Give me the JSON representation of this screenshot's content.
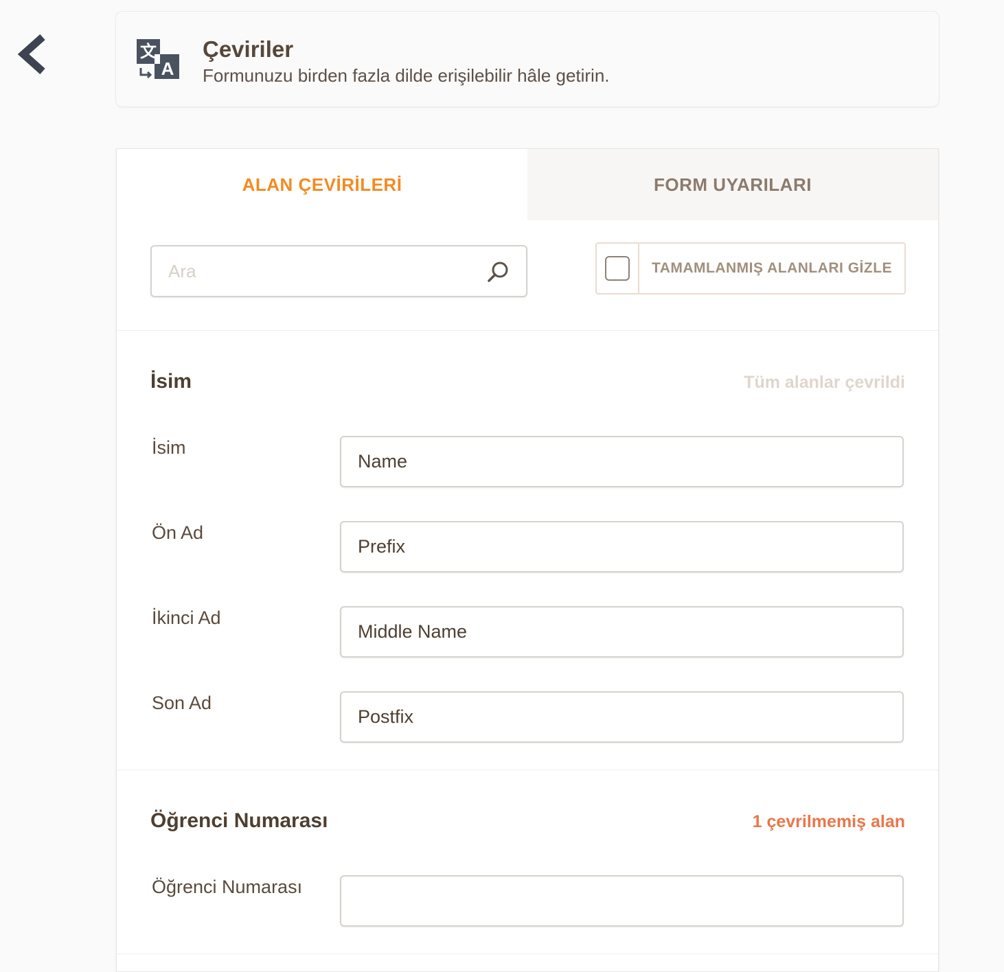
{
  "header": {
    "title": "Çeviriler",
    "subtitle": "Formunuzu birden fazla dilde erişilebilir hâle getirin."
  },
  "tabs": [
    {
      "label": "ALAN ÇEVİRİLERİ",
      "active": true
    },
    {
      "label": "FORM UYARILARI",
      "active": false
    }
  ],
  "search": {
    "placeholder": "Ara",
    "value": ""
  },
  "hide_completed": {
    "label": "TAMAMLANMIŞ ALANLARI GİZLE",
    "checked": false
  },
  "sections": [
    {
      "title": "İsim",
      "status": "Tüm alanlar çevrildi",
      "fields": [
        {
          "label": "İsim",
          "value": "Name"
        },
        {
          "label": "Ön Ad",
          "value": "Prefix"
        },
        {
          "label": "İkinci Ad",
          "value": "Middle Name"
        },
        {
          "label": "Son Ad",
          "value": "Postfix"
        }
      ]
    },
    {
      "title": "Öğrenci Numarası",
      "status": "1 çevrilmemiş alan",
      "fields": [
        {
          "label": "Öğrenci Numarası",
          "value": ""
        }
      ]
    }
  ],
  "colors": {
    "accent": "#f28b22",
    "pending": "#e8774b",
    "done": "#e0d6cc",
    "back_arrow": "#3d4350"
  },
  "icons": [
    "chevron-left-icon",
    "translate-icon",
    "search-icon",
    "checkbox-icon"
  ]
}
